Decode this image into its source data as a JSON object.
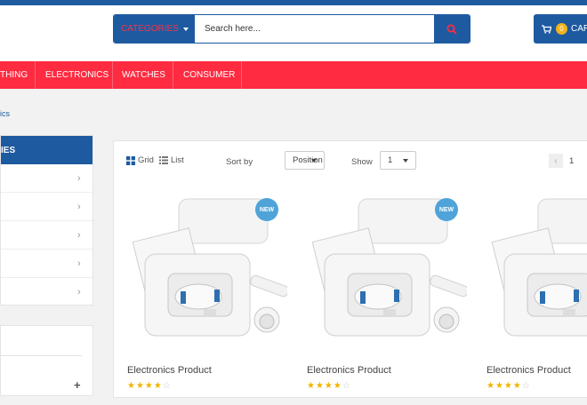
{
  "header": {
    "categories_label": "CATEGORIES",
    "search_placeholder": "Search here...",
    "cart_label": "CAR",
    "cart_count": "0"
  },
  "nav": {
    "items": [
      {
        "label": "THING"
      },
      {
        "label": "ELECTRONICS"
      },
      {
        "label": "WATCHES"
      },
      {
        "label": "CONSUMER"
      }
    ]
  },
  "breadcrumb": {
    "current": "ics"
  },
  "sidebar": {
    "title": "IES"
  },
  "toolbar": {
    "grid_label": "Grid",
    "list_label": "List",
    "sort_label": "Sort by",
    "sort_value": "Position",
    "show_label": "Show",
    "show_value": "1",
    "page": "1"
  },
  "products": [
    {
      "title": "Electronics Product",
      "badge": "NEW",
      "rating": 4,
      "max_rating": 5
    },
    {
      "title": "Electronics Product",
      "badge": "NEW",
      "rating": 4,
      "max_rating": 5
    },
    {
      "title": "Electronics Product",
      "badge": "",
      "rating": 4,
      "max_rating": 5
    }
  ],
  "colors": {
    "primary": "#1e5aa0",
    "nav_red": "#ff2b41",
    "badge_blue": "#4fa3d8",
    "star": "#f0b400"
  }
}
